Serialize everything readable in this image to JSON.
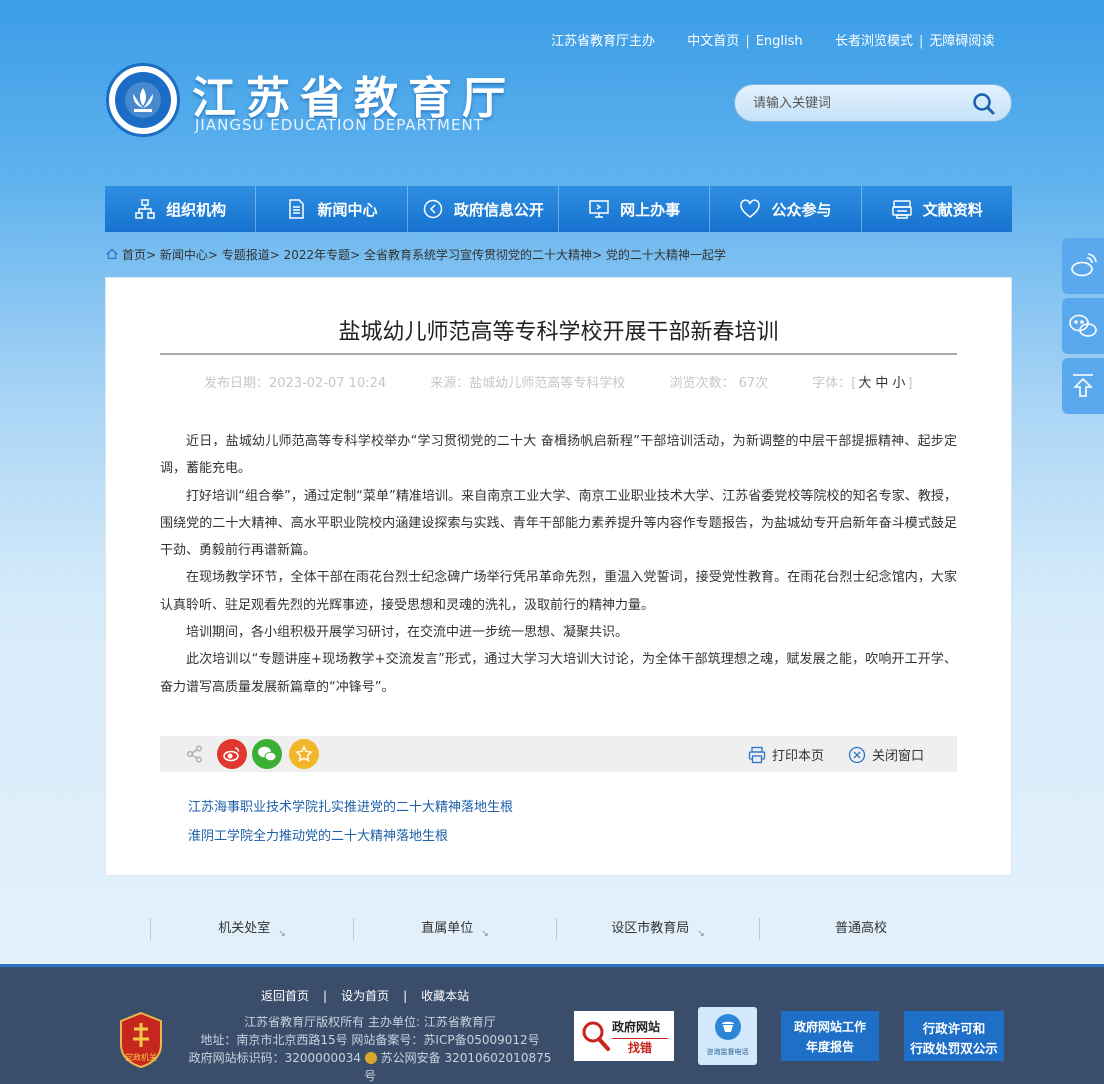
{
  "top_links": {
    "host": "江苏省教育厅主办",
    "cn_home": "中文首页",
    "english": "English",
    "elder_mode": "长者浏览模式",
    "accessible": "无障碍阅读"
  },
  "logo": {
    "cn": "江苏省教育厅",
    "en": "JIANGSU EDUCATION DEPARTMENT"
  },
  "search": {
    "placeholder": "请输入关键词"
  },
  "nav": [
    {
      "label": "组织机构",
      "icon": "org-chart-icon"
    },
    {
      "label": "新闻中心",
      "icon": "document-icon"
    },
    {
      "label": "政府信息公开",
      "icon": "play-circle-icon"
    },
    {
      "label": "网上办事",
      "icon": "monitor-icon"
    },
    {
      "label": "公众参与",
      "icon": "heart-icon"
    },
    {
      "label": "文献资料",
      "icon": "printer-icon"
    }
  ],
  "breadcrumb": "首页> 新闻中心> 专题报道> 2022年专题> 全省教育系统学习宣传贯彻党的二十大精神> 党的二十大精神一起学",
  "article": {
    "title": "盐城幼儿师范高等专科学校开展干部新春培训",
    "date": "发布日期：2023-02-07 10:24",
    "source": "来源：盐城幼儿师范高等专科学校",
    "views": "浏览次数：  67次",
    "font_label": "字体：[",
    "font_large": "大",
    "font_medium": "中",
    "font_small": "小",
    "font_end": "]",
    "paragraphs": [
      "近日，盐城幼儿师范高等专科学校举办“学习贯彻党的二十大 奋楫扬帆启新程”干部培训活动，为新调整的中层干部提振精神、起步定调，蓄能充电。",
      "打好培训“组合拳”，通过定制“菜单”精准培训。来自南京工业大学、南京工业职业技术大学、江苏省委党校等院校的知名专家、教授，围绕党的二十大精神、高水平职业院校内涵建设探索与实践、青年干部能力素养提升等内容作专题报告，为盐城幼专开启新年奋斗模式鼓足干劲、勇毅前行再谱新篇。",
      "在现场教学环节，全体干部在雨花台烈士纪念碑广场举行凭吊革命先烈，重温入党誓词，接受党性教育。在雨花台烈士纪念馆内，大家认真聆听、驻足观看先烈的光辉事迹，接受思想和灵魂的洗礼，汲取前行的精神力量。",
      "培训期间，各小组积极开展学习研讨，在交流中进一步统一思想、凝聚共识。",
      "此次培训以“专题讲座+现场教学+交流发言”形式，通过大学习大培训大讨论，为全体干部筑理想之魂，赋发展之能，吹响开工开学、奋力谱写高质量发展新篇章的“冲锋号”。"
    ],
    "print_label": "打印本页",
    "close_label": "关闭窗口",
    "related": [
      "江苏海事职业技术学院扎实推进党的二十大精神落地生根",
      "淮阴工学院全力推动党的二十大精神落地生根"
    ]
  },
  "bottom_links": [
    "机关处室",
    "直属单位",
    "设区市教育局",
    "普通高校"
  ],
  "footer": {
    "links": [
      "返回首页",
      "设为首页",
      "收藏本站"
    ],
    "separator": "|",
    "copyright": "江苏省教育厅版权所有 主办单位: 江苏省教育厅",
    "address": "地址：南京市北京西路15号 网站备案号：苏ICP备05009012号",
    "site_id": "政府网站标识码：3200000034",
    "police": "苏公网安备 32010602010875号",
    "badge_text": "党政机关",
    "error_top": "政府网站",
    "error_bottom": "找错",
    "hotline": "咨询监督电话",
    "report_line1": "政府网站工作",
    "report_line2": "年度报告",
    "permit_line1": "行政许可和",
    "permit_line2": "行政处罚双公示"
  },
  "colors": {
    "nav_blue": "#1672cf",
    "footer_bg": "#3a4e6b",
    "link_blue": "#1d5fa8",
    "weibo_red": "#e0382e",
    "wechat_green": "#3cb034",
    "favorite_yellow": "#f2b62b"
  }
}
